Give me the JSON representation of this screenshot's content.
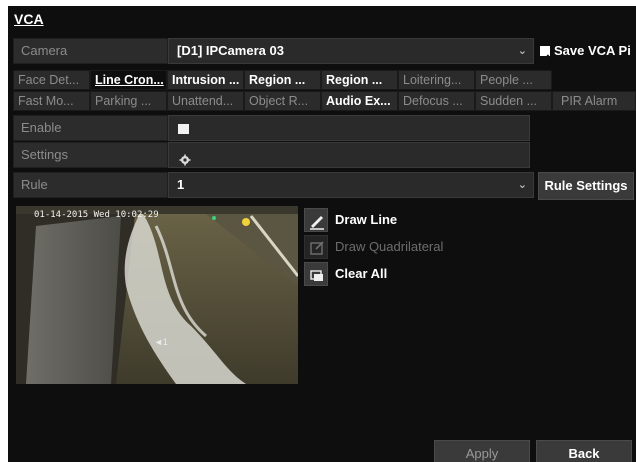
{
  "window": {
    "title": "VCA"
  },
  "camera": {
    "label": "Camera",
    "value": "[D1] IPCamera 03",
    "save_label": "Save VCA Pi"
  },
  "tabs_row1": [
    {
      "label": "Face Det...",
      "style": "normal"
    },
    {
      "label": "Line Cron...",
      "style": "active"
    },
    {
      "label": "Intrusion ...",
      "style": "bold"
    },
    {
      "label": "Region ...",
      "style": "bold"
    },
    {
      "label": "Region ...",
      "style": "bold"
    },
    {
      "label": "Loitering...",
      "style": "normal"
    },
    {
      "label": "People ...",
      "style": "normal"
    }
  ],
  "tabs_row2": [
    {
      "label": "Fast Mo...",
      "style": "normal"
    },
    {
      "label": "Parking ...",
      "style": "normal"
    },
    {
      "label": "Unattend...",
      "style": "normal"
    },
    {
      "label": "Object R...",
      "style": "normal"
    },
    {
      "label": "Audio Ex...",
      "style": "bold"
    },
    {
      "label": "Defocus ...",
      "style": "normal"
    },
    {
      "label": "Sudden ...",
      "style": "normal"
    },
    {
      "label": "PIR Alarm",
      "style": "normal"
    }
  ],
  "enable": {
    "label": "Enable",
    "checked": false
  },
  "settings": {
    "label": "Settings"
  },
  "rule": {
    "label": "Rule",
    "value": "1",
    "button": "Rule Settings"
  },
  "video": {
    "timestamp": "01-14-2015 Wed 10:02:29",
    "channel_label": "1"
  },
  "tools": {
    "draw_line": "Draw Line",
    "draw_quad": "Draw Quadrilateral",
    "clear_all": "Clear All"
  },
  "footer": {
    "apply": "Apply",
    "back": "Back"
  },
  "colors": {
    "background": "#0e0e0e",
    "panel": "#2c2c2c",
    "button": "#3a3a3a",
    "text": "#ffffff",
    "muted": "#8c8c8c"
  }
}
